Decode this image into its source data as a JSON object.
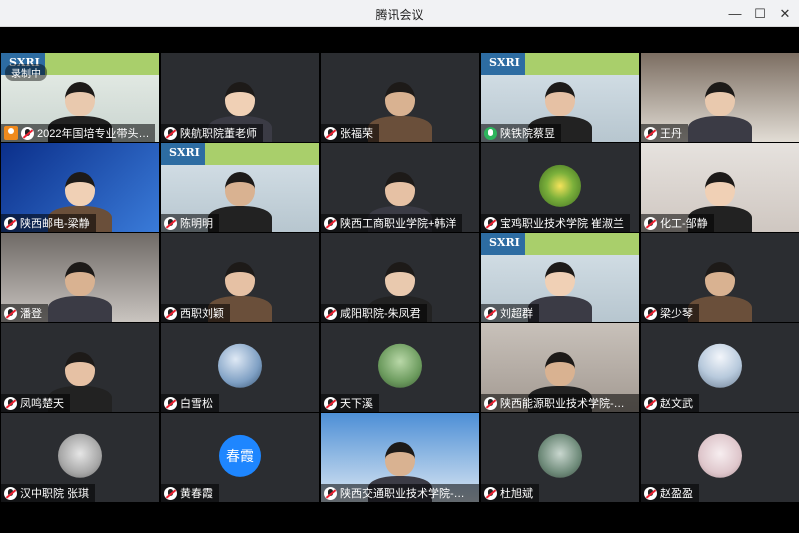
{
  "window": {
    "title": "腾讯会议",
    "minimize": "—",
    "maximize": "☐",
    "close": "✕"
  },
  "recording_label": "录制中",
  "participants": [
    {
      "name": "2022年国培专业带头…",
      "mic": "muted",
      "variant": "host"
    },
    {
      "name": "陕航职院董老师",
      "mic": "muted",
      "variant": "person"
    },
    {
      "name": "张福荣",
      "mic": "muted",
      "variant": "person"
    },
    {
      "name": "陕铁院蔡昱",
      "mic": "on",
      "variant": "banner"
    },
    {
      "name": "王丹",
      "mic": "muted",
      "variant": "person"
    },
    {
      "name": "陕西邮电-梁静",
      "mic": "muted",
      "variant": "blue"
    },
    {
      "name": "陈明明",
      "mic": "muted",
      "variant": "banner"
    },
    {
      "name": "陕西工商职业学院+韩洋",
      "mic": "muted",
      "variant": "person"
    },
    {
      "name": "宝鸡职业技术学院 崔淑兰",
      "mic": "muted",
      "variant": "plant"
    },
    {
      "name": "化工-邹静",
      "mic": "muted",
      "variant": "person"
    },
    {
      "name": "潘登",
      "mic": "muted",
      "variant": "person"
    },
    {
      "name": "西职刘颖",
      "mic": "muted",
      "variant": "person"
    },
    {
      "name": "咸阳职院-朱凤君",
      "mic": "muted",
      "variant": "person"
    },
    {
      "name": "刘超群",
      "mic": "muted",
      "variant": "banner"
    },
    {
      "name": "梁少琴",
      "mic": "muted",
      "variant": "person"
    },
    {
      "name": "凤鸣楚天",
      "mic": "muted",
      "variant": "person"
    },
    {
      "name": "白雪松",
      "mic": "muted",
      "variant": "avatar"
    },
    {
      "name": "天下溪",
      "mic": "muted",
      "variant": "avatar"
    },
    {
      "name": "陕西能源职业技术学院-丁…",
      "mic": "muted",
      "variant": "person"
    },
    {
      "name": "赵文武",
      "mic": "muted",
      "variant": "avatar"
    },
    {
      "name": "汉中职院 张琪",
      "mic": "muted",
      "variant": "avatar"
    },
    {
      "name": "黄春霞",
      "mic": "muted",
      "variant": "text-avatar",
      "avatar_text": "春霞"
    },
    {
      "name": "陕西交通职业技术学院-郭…",
      "mic": "muted",
      "variant": "person"
    },
    {
      "name": "杜旭斌",
      "mic": "muted",
      "variant": "avatar"
    },
    {
      "name": "赵盈盈",
      "mic": "muted",
      "variant": "avatar"
    }
  ],
  "banner_text": "SXRI",
  "colors": {
    "tile_bg": "#303236",
    "mic_muted_slash": "#e23",
    "mic_on": "#2db55d",
    "text_avatar": "#1e86ff",
    "host_badge": "#f08a1c"
  }
}
